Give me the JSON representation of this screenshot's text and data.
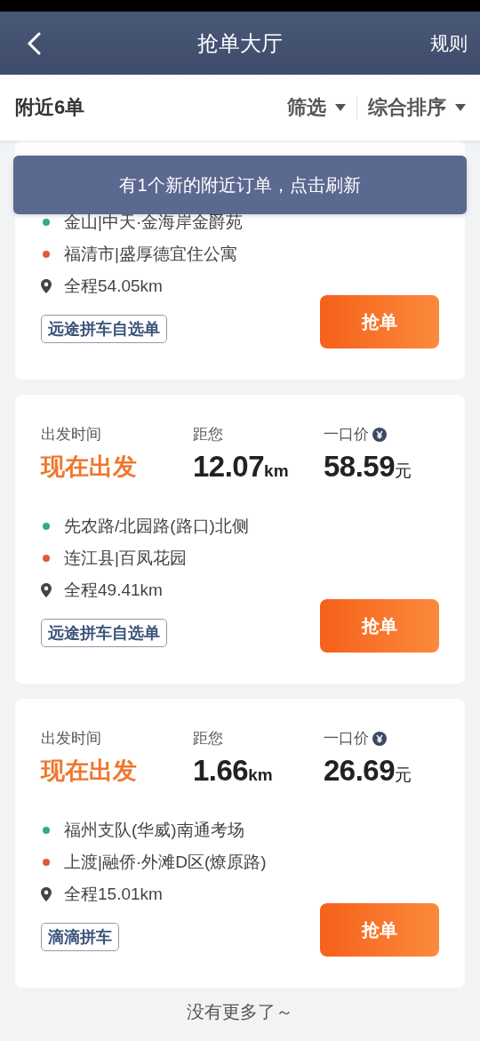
{
  "header": {
    "title": "抢单大厅",
    "action": "规则"
  },
  "filter_bar": {
    "count": "附近6单",
    "filters": [
      {
        "label": "筛选"
      },
      {
        "label": "综合排序"
      }
    ]
  },
  "toast": "有1个新的附近订单，点击刷新",
  "orders": [
    {
      "kind": "partial",
      "start": "金山|中天·金海岸金爵苑",
      "end": "福清市|盛厚德宜住公寓",
      "total": "全程54.05km",
      "tag": "远途拼车自选单",
      "button": "抢单"
    },
    {
      "kind": "full",
      "departure_label": "出发时间",
      "departure": "现在出发",
      "distance_label": "距您",
      "distance": "12.07",
      "distance_unit": "km",
      "price_label": "一口价",
      "price": "58.59",
      "price_unit": "元",
      "start": "先农路/北园路(路口)北侧",
      "end": "连江县|百凤花园",
      "total": "全程49.41km",
      "tag": "远途拼车自选单",
      "button": "抢单"
    },
    {
      "kind": "full",
      "departure_label": "出发时间",
      "departure": "现在出发",
      "distance_label": "距您",
      "distance": "1.66",
      "distance_unit": "km",
      "price_label": "一口价",
      "price": "26.69",
      "price_unit": "元",
      "start": "福州支队(华威)南通考场",
      "end": "上渡|融侨·外滩D区(燎原路)",
      "total": "全程15.01km",
      "tag": "滴滴拼车",
      "button": "抢单"
    }
  ],
  "footer": "没有更多了～"
}
